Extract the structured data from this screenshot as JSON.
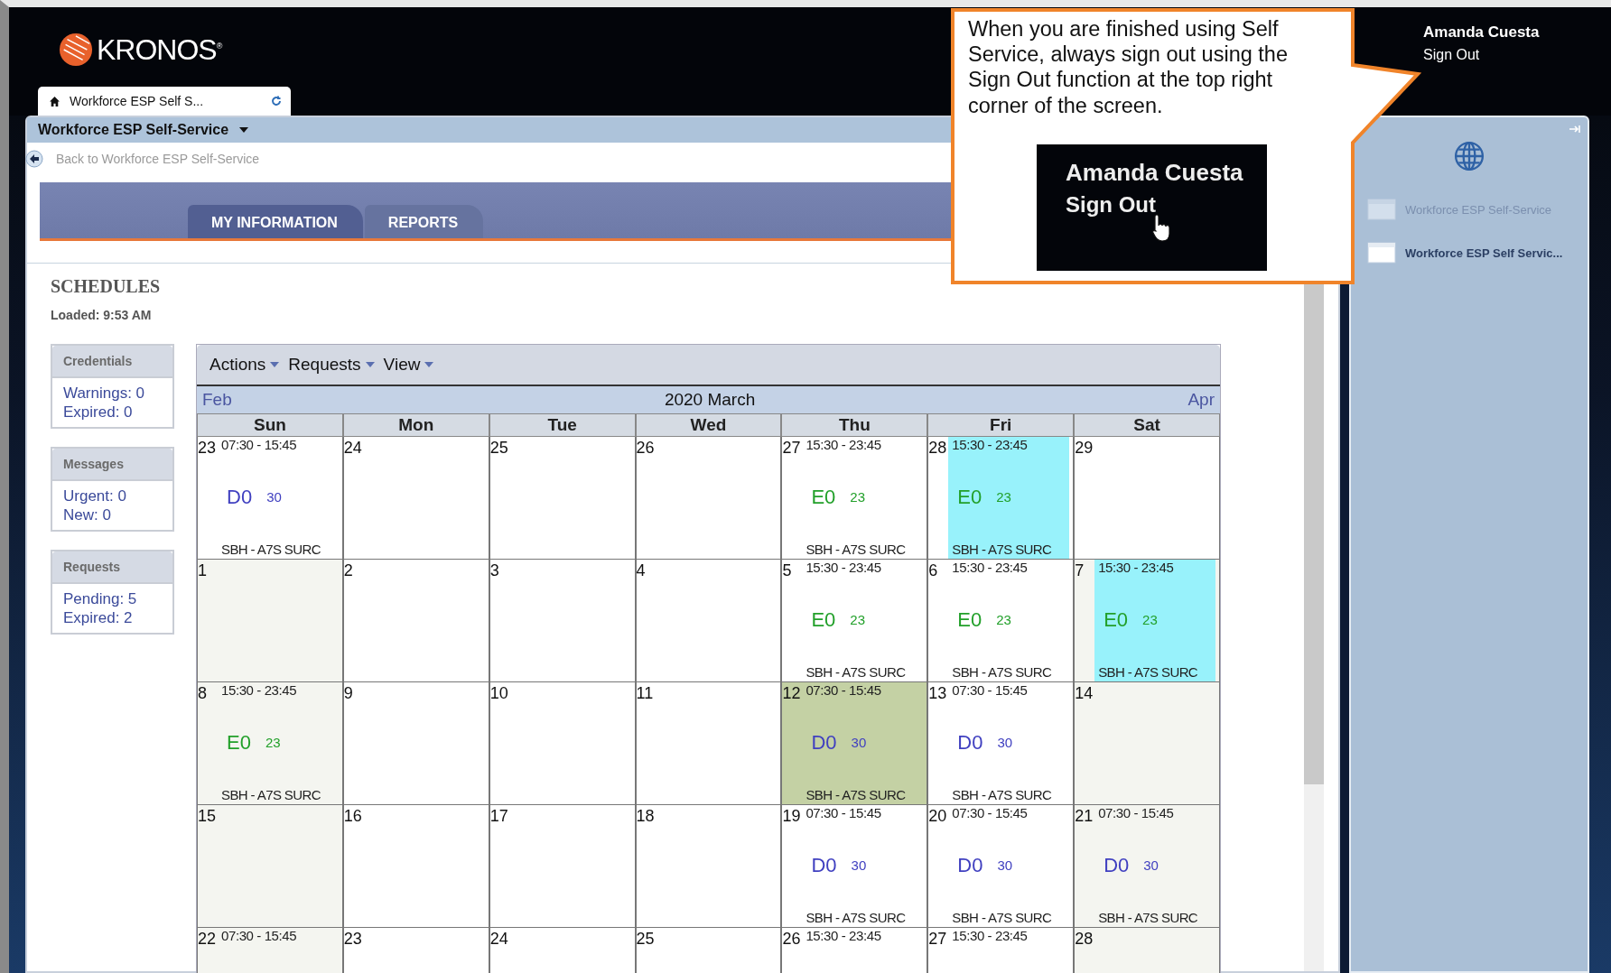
{
  "header": {
    "logo": "KRONOS$^{®}$",
    "user": "Amanda Cuesta",
    "sign_out": "Sign Out"
  },
  "app_tab": {
    "label": "Workforce ESP Self S..."
  },
  "title_bar": {
    "title": "Workforce ESP Self-Service"
  },
  "back_link": "Back to Workforce ESP Self-Service",
  "nav_tabs": [
    {
      "label": "MY INFORMATION",
      "selected": true
    },
    {
      "label": "REPORTS",
      "selected": false
    }
  ],
  "page": {
    "title": "SCHEDULES",
    "loaded": "Loaded: 9:53 AM"
  },
  "summary_boxes": [
    {
      "title": "Credentials",
      "lines": [
        "Warnings: 0",
        "Expired: 0"
      ]
    },
    {
      "title": "Messages",
      "lines": [
        "Urgent: 0",
        "New: 0"
      ]
    },
    {
      "title": "Requests",
      "lines": [
        "Pending: 5",
        "Expired: 2"
      ]
    }
  ],
  "calendar": {
    "menus": [
      "Actions",
      "Requests",
      "View"
    ],
    "prev": "Feb",
    "month": "2020 March",
    "next": "Apr",
    "weekdays": [
      "Sun",
      "Mon",
      "Tue",
      "Wed",
      "Thu",
      "Fri",
      "Sat"
    ],
    "weeks": [
      [
        {
          "date": "23",
          "shaded": false,
          "selected": false,
          "shift": {
            "time": "07:30 - 15:45",
            "code": "D0",
            "count": "30",
            "location": "SBH - A7S SURC",
            "color": "#4040c0",
            "highlight": false
          }
        },
        {
          "date": "24",
          "shaded": false,
          "selected": false
        },
        {
          "date": "25",
          "shaded": false,
          "selected": false
        },
        {
          "date": "26",
          "shaded": false,
          "selected": false
        },
        {
          "date": "27",
          "shaded": false,
          "selected": false,
          "shift": {
            "time": "15:30 - 23:45",
            "code": "E0",
            "count": "23",
            "location": "SBH - A7S SURC",
            "color": "#22a02a",
            "highlight": false
          }
        },
        {
          "date": "28",
          "shaded": false,
          "selected": false,
          "shift": {
            "time": "15:30 - 23:45",
            "code": "E0",
            "count": "23",
            "location": "SBH - A7S SURC",
            "color": "#22a02a",
            "highlight": true
          }
        },
        {
          "date": "29",
          "shaded": false,
          "selected": false
        }
      ],
      [
        {
          "date": "1",
          "shaded": true,
          "selected": false
        },
        {
          "date": "2",
          "shaded": false,
          "selected": false
        },
        {
          "date": "3",
          "shaded": false,
          "selected": false
        },
        {
          "date": "4",
          "shaded": false,
          "selected": false
        },
        {
          "date": "5",
          "shaded": false,
          "selected": false,
          "shift": {
            "time": "15:30 - 23:45",
            "code": "E0",
            "count": "23",
            "location": "SBH - A7S SURC",
            "color": "#22a02a",
            "highlight": false
          }
        },
        {
          "date": "6",
          "shaded": false,
          "selected": false,
          "shift": {
            "time": "15:30 - 23:45",
            "code": "E0",
            "count": "23",
            "location": "SBH - A7S SURC",
            "color": "#22a02a",
            "highlight": false
          }
        },
        {
          "date": "7",
          "shaded": true,
          "selected": false,
          "shift": {
            "time": "15:30 - 23:45",
            "code": "E0",
            "count": "23",
            "location": "SBH - A7S SURC",
            "color": "#22a02a",
            "highlight": true
          }
        }
      ],
      [
        {
          "date": "8",
          "shaded": true,
          "selected": false,
          "shift": {
            "time": "15:30 - 23:45",
            "code": "E0",
            "count": "23",
            "location": "SBH - A7S SURC",
            "color": "#22a02a",
            "highlight": false
          }
        },
        {
          "date": "9",
          "shaded": false,
          "selected": false
        },
        {
          "date": "10",
          "shaded": false,
          "selected": false
        },
        {
          "date": "11",
          "shaded": false,
          "selected": false
        },
        {
          "date": "12",
          "shaded": false,
          "selected": true,
          "shift": {
            "time": "07:30 - 15:45",
            "code": "D0",
            "count": "30",
            "location": "SBH - A7S SURC",
            "color": "#4040c0",
            "highlight": false
          }
        },
        {
          "date": "13",
          "shaded": false,
          "selected": false,
          "shift": {
            "time": "07:30 - 15:45",
            "code": "D0",
            "count": "30",
            "location": "SBH - A7S SURC",
            "color": "#4040c0",
            "highlight": false
          }
        },
        {
          "date": "14",
          "shaded": true,
          "selected": false
        }
      ],
      [
        {
          "date": "15",
          "shaded": true,
          "selected": false
        },
        {
          "date": "16",
          "shaded": false,
          "selected": false
        },
        {
          "date": "17",
          "shaded": false,
          "selected": false
        },
        {
          "date": "18",
          "shaded": false,
          "selected": false
        },
        {
          "date": "19",
          "shaded": false,
          "selected": false,
          "shift": {
            "time": "07:30 - 15:45",
            "code": "D0",
            "count": "30",
            "location": "SBH - A7S SURC",
            "color": "#4040c0",
            "highlight": false
          }
        },
        {
          "date": "20",
          "shaded": false,
          "selected": false,
          "shift": {
            "time": "07:30 - 15:45",
            "code": "D0",
            "count": "30",
            "location": "SBH - A7S SURC",
            "color": "#4040c0",
            "highlight": false
          }
        },
        {
          "date": "21",
          "shaded": true,
          "selected": false,
          "shift": {
            "time": "07:30 - 15:45",
            "code": "D0",
            "count": "30",
            "location": "SBH - A7S SURC",
            "color": "#4040c0",
            "highlight": false
          }
        }
      ],
      [
        {
          "date": "22",
          "shaded": true,
          "selected": false,
          "shift": {
            "time": "07:30 - 15:45"
          }
        },
        {
          "date": "23",
          "shaded": false,
          "selected": false
        },
        {
          "date": "24",
          "shaded": false,
          "selected": false
        },
        {
          "date": "25",
          "shaded": false,
          "selected": false
        },
        {
          "date": "26",
          "shaded": false,
          "selected": false,
          "shift": {
            "time": "15:30 - 23:45"
          }
        },
        {
          "date": "27",
          "shaded": false,
          "selected": false,
          "shift": {
            "time": "15:30 - 23:45"
          }
        },
        {
          "date": "28",
          "shaded": true,
          "selected": false
        }
      ]
    ]
  },
  "right_panel": {
    "items": [
      {
        "label": "Workforce ESP Self-Service",
        "selected": false
      },
      {
        "label": "Workforce ESP Self Servic...",
        "selected": true
      }
    ]
  },
  "callout": {
    "text": "When you are finished using Self Service, always sign out using the Sign Out function at the top right corner of the screen.",
    "inset_user": "Amanda Cuesta",
    "inset_sign_out": "Sign Out"
  }
}
